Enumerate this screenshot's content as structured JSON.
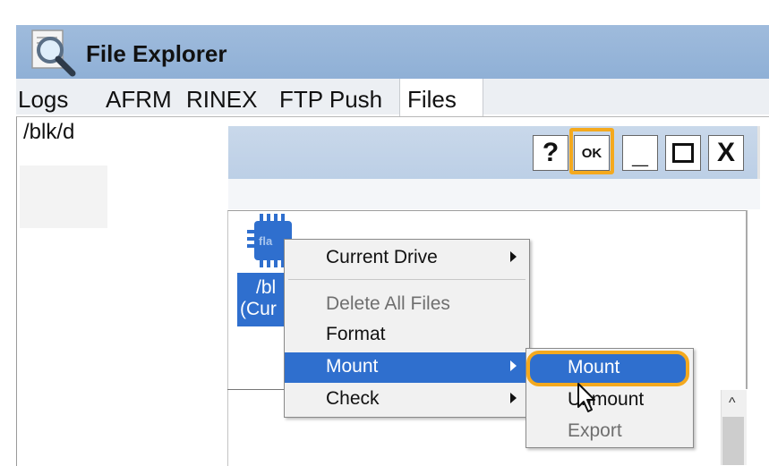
{
  "window": {
    "title": "File Explorer",
    "icon": "magnifier-icon"
  },
  "tabs": [
    {
      "label": "Logs"
    },
    {
      "label": "AFRM"
    },
    {
      "label": "RINEX"
    },
    {
      "label": "FTP Push"
    },
    {
      "label": "Files",
      "selected": true
    }
  ],
  "content": {
    "path": "/blk/d"
  },
  "dialog": {
    "buttons": {
      "help": "?",
      "ok": "OK",
      "minimize": "_",
      "maximize": "□",
      "close": "X"
    },
    "highlight_color": "#f4a91e"
  },
  "drive": {
    "icon_text": "fla",
    "label_line1": "/bl",
    "label_line2": "(Cur"
  },
  "context_menu": {
    "items": [
      {
        "label": "Current Drive",
        "submenu": true,
        "enabled": true
      },
      {
        "label": "Delete All Files",
        "submenu": false,
        "enabled": false
      },
      {
        "label": "Format",
        "submenu": false,
        "enabled": true
      },
      {
        "label": "Mount",
        "submenu": true,
        "enabled": true,
        "highlighted": true
      },
      {
        "label": "Check",
        "submenu": true,
        "enabled": true
      }
    ],
    "highlight_color": "#2f6fce"
  },
  "submenu": {
    "items": [
      {
        "label": "Mount",
        "enabled": true,
        "highlighted": true
      },
      {
        "label": "Unmount",
        "enabled": true
      },
      {
        "label": "Export",
        "enabled": false
      }
    ]
  },
  "scrollbar": {
    "up_arrow": "^"
  }
}
